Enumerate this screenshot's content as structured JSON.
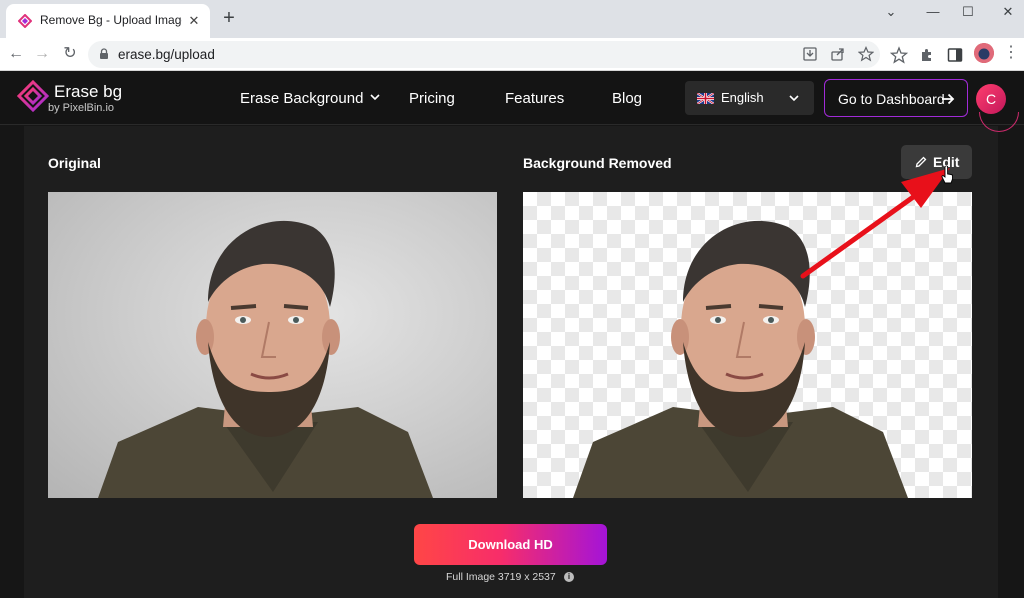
{
  "browser": {
    "tab_title": "Remove Bg - Upload Images f",
    "tab_close_glyph": "✕",
    "new_tab_glyph": "+",
    "url": "erase.bg/upload",
    "window_controls": {
      "minimize": "—",
      "maximize": "☐",
      "close": "✕"
    },
    "nav": {
      "back": "←",
      "forward": "→",
      "reload": "↻"
    },
    "kebab_glyph": "⋮"
  },
  "header": {
    "logo_title": "Erase bg",
    "logo_subtitle": "by PixelBin.io",
    "nav_items": {
      "erase_background": "Erase Background",
      "pricing": "Pricing",
      "features": "Features",
      "blog": "Blog"
    },
    "language": "English",
    "dashboard_label": "Go to Dashboard",
    "avatar_initial": "C"
  },
  "main": {
    "original_label": "Original",
    "removed_label": "Background Removed",
    "edit_label": "Edit",
    "download_label": "Download HD",
    "size_text": "Full Image 3719 x 2537",
    "info_glyph": "i"
  },
  "colors": {
    "accent_purple": "#a12bd8",
    "download_gradient_start": "#ff4646",
    "download_gradient_end": "#a414d8",
    "annotation_arrow": "#e8101a"
  }
}
